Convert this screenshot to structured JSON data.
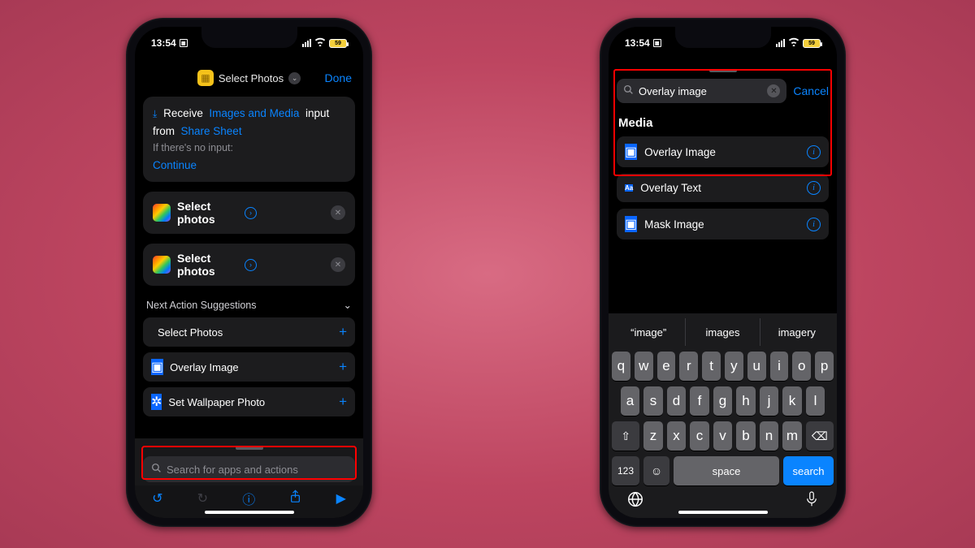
{
  "status": {
    "time": "13:54",
    "battery": "59"
  },
  "left": {
    "header": {
      "title": "Select Photos",
      "done": "Done"
    },
    "receive": {
      "word_receive": "Receive",
      "types": "Images and Media",
      "input_word": "input from",
      "source": "Share Sheet",
      "noinput_label": "If there's no input:",
      "noinput_action": "Continue"
    },
    "actions": [
      {
        "label": "Select photos"
      },
      {
        "label": "Select photos"
      }
    ],
    "suggestions_header": "Next Action Suggestions",
    "suggestions": [
      {
        "label": "Select Photos",
        "icon": "photos"
      },
      {
        "label": "Overlay Image",
        "icon": "overlay"
      },
      {
        "label": "Set Wallpaper Photo",
        "icon": "wall"
      }
    ],
    "search_placeholder": "Search for apps and actions"
  },
  "right": {
    "search_value": "Overlay image",
    "cancel": "Cancel",
    "section": "Media",
    "results": [
      {
        "label": "Overlay Image",
        "icon": "overlay"
      },
      {
        "label": "Overlay Text",
        "icon": "txt",
        "glyph": "Aa"
      },
      {
        "label": "Mask Image",
        "icon": "overlay"
      }
    ],
    "predictions": [
      "“image”",
      "images",
      "imagery"
    ],
    "kb": {
      "r1": [
        "q",
        "w",
        "e",
        "r",
        "t",
        "y",
        "u",
        "i",
        "o",
        "p"
      ],
      "r2": [
        "a",
        "s",
        "d",
        "f",
        "g",
        "h",
        "j",
        "k",
        "l"
      ],
      "r3": [
        "z",
        "x",
        "c",
        "v",
        "b",
        "n",
        "m"
      ],
      "num": "123",
      "space": "space",
      "search": "search"
    }
  }
}
